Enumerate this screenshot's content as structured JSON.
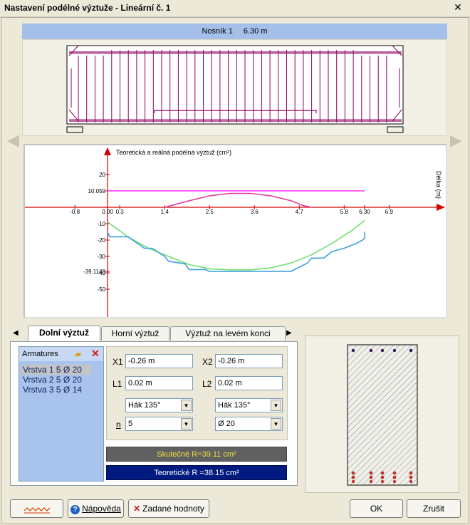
{
  "window": {
    "title": "Nastavení podélné výztuže - Lineární č. 1",
    "close_glyph": "✕"
  },
  "beam": {
    "name": "Nosník 1",
    "length": "6.30 m"
  },
  "chart_data": {
    "type": "line",
    "title": "Teoretická a reálná podélná výztuž (cm²)",
    "xlabel": "Délka (m)",
    "x_ticks": [
      "-0.8",
      "0.00",
      "0.3",
      "1.4",
      "2.5",
      "3.6",
      "4.7",
      "5.8",
      "6.30",
      "6.9"
    ],
    "y_ticks": [
      "20",
      "10.059",
      "0",
      "-10",
      "-20",
      "-30",
      "-39.1148",
      "-40",
      "-50"
    ],
    "xlim": [
      -1.6,
      8.0
    ],
    "ylim": [
      -65,
      30
    ],
    "series": [
      {
        "color": "#ff40ff",
        "x": [
          0,
          6.3
        ],
        "y": [
          10.059,
          10.059
        ]
      },
      {
        "color": "#e040a0",
        "x": [
          1.4,
          2.0,
          2.5,
          3.0,
          3.5,
          4.0,
          4.5,
          4.8,
          5.0
        ],
        "y": [
          0,
          4,
          7,
          8.5,
          8.5,
          7,
          4,
          1,
          0
        ]
      },
      {
        "color": "#70e070",
        "x": [
          0,
          0.5,
          1.0,
          1.5,
          2.0,
          2.5,
          3.0,
          3.5,
          4.0,
          4.5,
          5.0,
          5.5,
          6.0,
          6.3
        ],
        "y": [
          -9,
          -18,
          -25,
          -30,
          -35,
          -37.5,
          -38.2,
          -38.2,
          -37,
          -34,
          -29,
          -22,
          -14,
          -8
        ]
      },
      {
        "color": "#40a0e0",
        "x": [
          0,
          0.05,
          0.5,
          0.9,
          1.1,
          1.4,
          1.5,
          1.9,
          2.0,
          2.4,
          2.5,
          3.5,
          4.5,
          4.9,
          5.0,
          5.3,
          5.5,
          5.8,
          6.1,
          6.25,
          6.3,
          6.3
        ],
        "y": [
          -15,
          -18,
          -18,
          -25,
          -25,
          -30,
          -33,
          -34.5,
          -38,
          -38,
          -39.1,
          -39.1,
          -39.1,
          -34,
          -31,
          -31,
          -27,
          -25,
          -22,
          -20,
          -19,
          -15
        ]
      }
    ]
  },
  "tabs": [
    {
      "label": "Dolní výztuž",
      "active": true
    },
    {
      "label": "Horní výztuž",
      "active": false
    },
    {
      "label": "Výztuž na levém konci",
      "active": false
    }
  ],
  "armatures": {
    "header": "Armatures",
    "items": [
      "Vrstva 1 5 Ø 20",
      "Vrstva 2 5 Ø 20",
      "Vrstva 3 5 Ø 14"
    ],
    "selected_index": 0
  },
  "params": {
    "x1_label": "X1",
    "x1_value": "-0.26 m",
    "x2_label": "X2",
    "x2_value": "-0.26 m",
    "l1_label": "L1",
    "l1_value": "0.02 m",
    "l2_label": "L2",
    "l2_value": "0.02 m",
    "hook_left": "Hák 135°",
    "hook_right": "Hák 135°",
    "n_label": "n",
    "n_value": "5",
    "diameter_value": "Ø 20"
  },
  "results": {
    "real": "Skutečné R=39.11 cm²",
    "theoretical": "Teoretické R =38.15 cm²"
  },
  "buttons": {
    "help": "Nápověda",
    "entered_values": "Zadané hodnoty",
    "ok": "OK",
    "cancel": "Zrušit"
  },
  "colors": {
    "beam_rebar": "#900060",
    "axis": "#d00000"
  }
}
